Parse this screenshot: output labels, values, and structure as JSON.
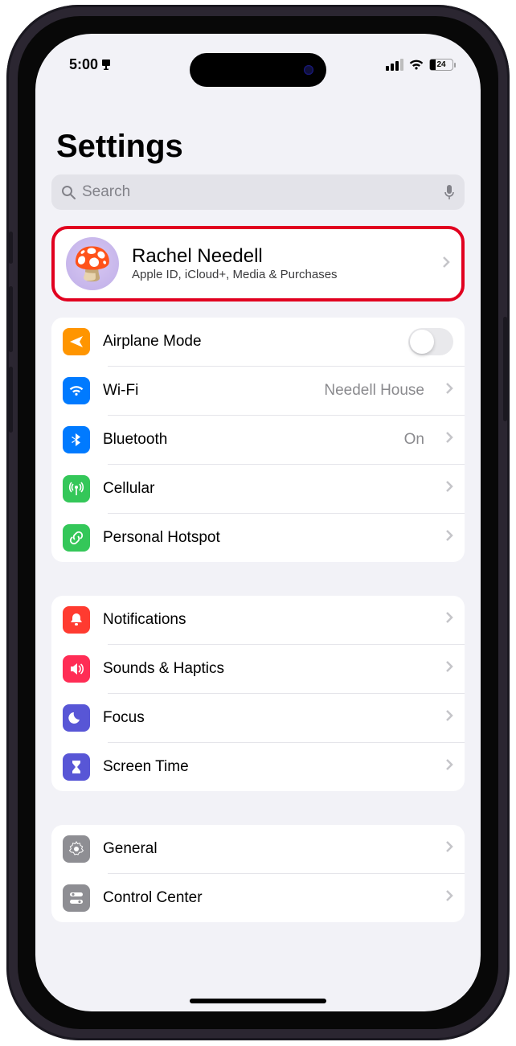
{
  "status": {
    "time": "5:00",
    "battery_pct": "24"
  },
  "page": {
    "title": "Settings",
    "search_placeholder": "Search"
  },
  "account": {
    "name": "Rachel Needell",
    "subtitle": "Apple ID, iCloud+, Media & Purchases",
    "avatar_emoji": "🍄"
  },
  "group1": [
    {
      "key": "airplane",
      "label": "Airplane Mode",
      "icon": "airplane",
      "color": "orange",
      "type": "toggle",
      "on": false
    },
    {
      "key": "wifi",
      "label": "Wi-Fi",
      "icon": "wifi",
      "color": "blue",
      "type": "link",
      "detail": "Needell House"
    },
    {
      "key": "bluetooth",
      "label": "Bluetooth",
      "icon": "bluetooth",
      "color": "blue",
      "type": "link",
      "detail": "On"
    },
    {
      "key": "cellular",
      "label": "Cellular",
      "icon": "antenna",
      "color": "green",
      "type": "link"
    },
    {
      "key": "hotspot",
      "label": "Personal Hotspot",
      "icon": "link",
      "color": "green",
      "type": "link"
    }
  ],
  "group2": [
    {
      "key": "notifications",
      "label": "Notifications",
      "icon": "bell",
      "color": "red",
      "type": "link"
    },
    {
      "key": "sounds",
      "label": "Sounds & Haptics",
      "icon": "speaker",
      "color": "pink",
      "type": "link"
    },
    {
      "key": "focus",
      "label": "Focus",
      "icon": "moon",
      "color": "indigo",
      "type": "link"
    },
    {
      "key": "screentime",
      "label": "Screen Time",
      "icon": "hourglass",
      "color": "indigo",
      "type": "link"
    }
  ],
  "group3": [
    {
      "key": "general",
      "label": "General",
      "icon": "gear",
      "color": "gray",
      "type": "link"
    },
    {
      "key": "controlcenter",
      "label": "Control Center",
      "icon": "toggles",
      "color": "gray",
      "type": "link"
    }
  ]
}
